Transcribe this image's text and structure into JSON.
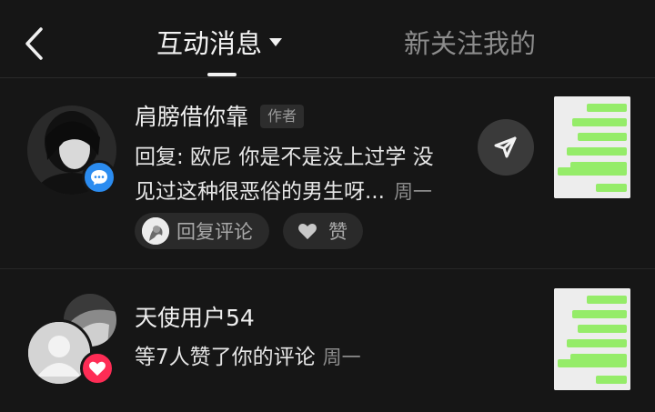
{
  "header": {
    "back_icon": "chevron-left-icon",
    "tab_active": "互动消息",
    "tab_inactive": "新关注我的"
  },
  "notifications": [
    {
      "name": "肩膀借你靠",
      "tag": "作者",
      "message": "回复: 欧尼 你是不是没上过学 没见过这种很恶俗的男生呀...",
      "time": "周一",
      "reply_label": "回复评论",
      "like_label": "赞",
      "badge_icon": "comment-icon",
      "action_icon": "send-icon"
    },
    {
      "name": "天使用户54",
      "message": "等7人赞了你的评论",
      "time": "周一",
      "badge_icon": "heart-icon"
    }
  ],
  "colors": {
    "background": "#161616",
    "comment_badge": "#2b8cf0",
    "like_badge": "#fe2c55",
    "chat_bubble": "#95ec69"
  }
}
